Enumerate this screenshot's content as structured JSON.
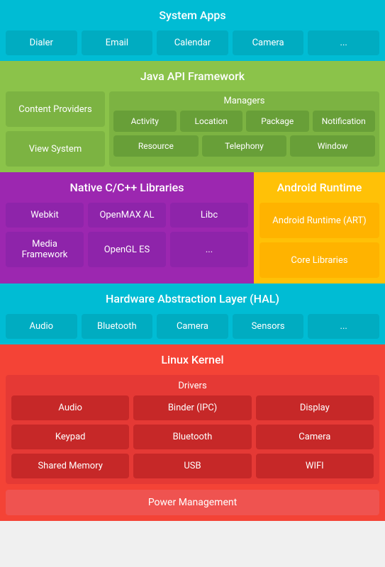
{
  "systemApps": {
    "title": "System Apps",
    "items": [
      "Dialer",
      "Email",
      "Calendar",
      "Camera",
      "..."
    ]
  },
  "javaApi": {
    "title": "Java API Framework",
    "contentProviders": "Content Providers",
    "viewSystem": "View System",
    "managers": {
      "title": "Managers",
      "row1": [
        "Activity",
        "Location",
        "Package",
        "Notification"
      ],
      "row2": [
        "Resource",
        "Telephony",
        "Window"
      ]
    }
  },
  "nativeCpp": {
    "title": "Native C/C++ Libraries",
    "row1": [
      "Webkit",
      "OpenMAX AL",
      "Libc"
    ],
    "row2": [
      "Media Framework",
      "OpenGL ES",
      "..."
    ]
  },
  "androidRuntime": {
    "title": "Android Runtime",
    "art": "Android Runtime (ART)",
    "core": "Core Libraries"
  },
  "hal": {
    "title": "Hardware Abstraction Layer (HAL)",
    "items": [
      "Audio",
      "Bluetooth",
      "Camera",
      "Sensors",
      "..."
    ]
  },
  "linuxKernel": {
    "title": "Linux Kernel",
    "drivers": {
      "title": "Drivers",
      "items": [
        [
          "Audio",
          "Binder (IPC)",
          "Display"
        ],
        [
          "Keypad",
          "Bluetooth",
          "Camera"
        ],
        [
          "Shared Memory",
          "USB",
          "WIFI"
        ]
      ]
    },
    "powerManagement": "Power Management"
  }
}
